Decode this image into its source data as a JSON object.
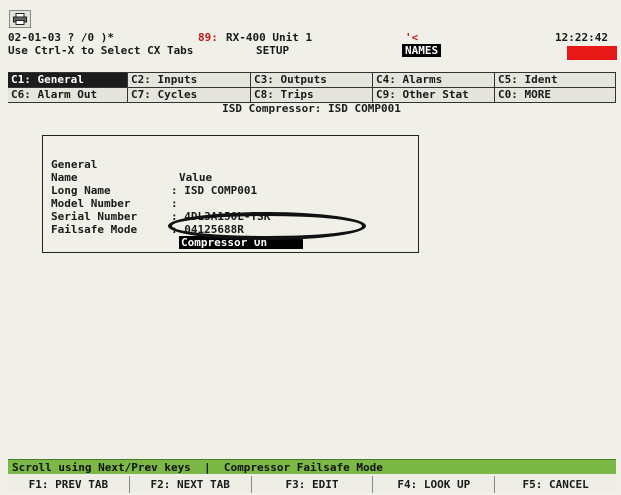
{
  "header": {
    "print_icon": "printer-icon",
    "status_line": "02-01-03 ? /0 )*",
    "unit_prefix": "89:",
    "unit_name": "RX-400 Unit 1",
    "comm_indicator": "'<",
    "clock": "12:22:42",
    "hint": "Use Ctrl-X to Select CX Tabs",
    "mode": "SETUP",
    "names_label": "NAMES",
    "alarm_color": "#e81818"
  },
  "tabs": {
    "row1": [
      "C1: General",
      "C2: Inputs",
      "C3: Outputs",
      "C4: Alarms",
      "C5: Ident"
    ],
    "row2": [
      "C6: Alarm Out",
      "C7: Cycles",
      "C8: Trips",
      "C9: Other Stat",
      "C0: MORE"
    ]
  },
  "subtitle": "ISD Compressor: ISD COMP001",
  "panel": {
    "header_label": "General",
    "header_value": "Value",
    "rows": [
      {
        "label": "Name",
        "value": ": ISD COMP001"
      },
      {
        "label": "Long Name",
        "value": ":"
      },
      {
        "label": "Model Number",
        "value": ": 4DL3A150L-TSK"
      },
      {
        "label": "Serial Number",
        "value": ": 04125688R"
      },
      {
        "label": "Failsafe Mode",
        "value": "Compressor On"
      }
    ]
  },
  "help_bar": "Scroll using Next/Prev keys  |  Compressor Failsafe Mode",
  "fkeys": [
    "F1: PREV TAB",
    "F2: NEXT TAB",
    "F3: EDIT",
    "F4: LOOK UP",
    "F5: CANCEL"
  ]
}
